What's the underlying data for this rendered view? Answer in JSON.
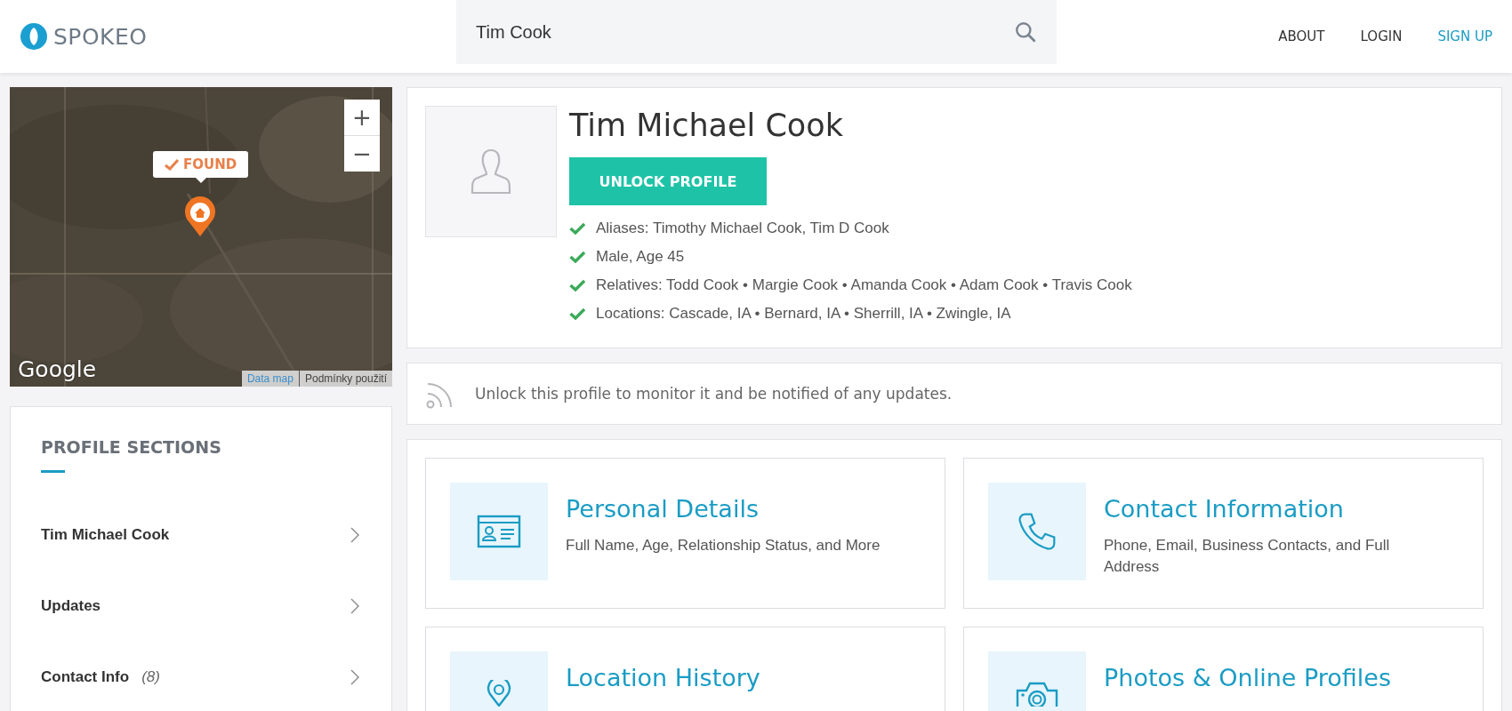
{
  "header": {
    "logo": "SPOKEO",
    "search": {
      "value": "Tim Cook"
    },
    "nav": [
      {
        "label": "ABOUT",
        "kind": "plain"
      },
      {
        "label": "LOGIN",
        "kind": "plain"
      },
      {
        "label": "SIGN UP",
        "kind": "accent"
      }
    ]
  },
  "map": {
    "marker_label": "FOUND",
    "zoom_in": "+",
    "zoom_out": "−",
    "logo": "Google",
    "attribution": [
      "Data map",
      "Podmínky použití"
    ]
  },
  "sidebar": {
    "title": "PROFILE SECTIONS",
    "items": [
      {
        "label": "Tim Michael Cook"
      },
      {
        "label": "Updates"
      },
      {
        "label": "Contact Info",
        "count": "(8)"
      }
    ]
  },
  "profile": {
    "name": "Tim Michael Cook",
    "button": "UNLOCK PROFILE",
    "facts": [
      "Aliases: Timothy Michael Cook, Tim D Cook",
      "Male, Age 45",
      "Relatives: Todd Cook • Margie Cook • Amanda Cook • Adam Cook • Travis Cook",
      "Locations: Cascade, IA • Bernard, IA • Sherrill, IA • Zwingle, IA"
    ]
  },
  "monitor": {
    "text": "Unlock this profile to monitor it and be notified of any updates."
  },
  "sections": [
    {
      "title": "Personal Details",
      "description": "Full Name, Age, Relationship Status, and More"
    },
    {
      "title": "Contact Information",
      "description": "Phone, Email, Business Contacts, and Full Address"
    },
    {
      "title": "Location History"
    },
    {
      "title": "Photos & Online Profiles"
    }
  ]
}
